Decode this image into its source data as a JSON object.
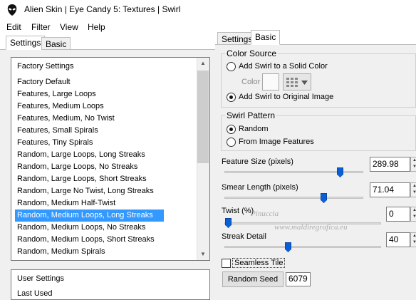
{
  "window": {
    "title": "Alien Skin | Eye Candy 5: Textures | Swirl",
    "icon": "alien-skin-app-icon"
  },
  "menu": [
    "Edit",
    "Filter",
    "View",
    "Help"
  ],
  "left_tabs": [
    "Settings",
    "Basic"
  ],
  "right_tabs": [
    "Settings",
    "Basic"
  ],
  "presets": {
    "header": "Factory Settings",
    "items": [
      "Factory Default",
      "Features, Large Loops",
      "Features, Medium Loops",
      "Features, Medium, No Twist",
      "Features, Small Spirals",
      "Features, Tiny Spirals",
      "Random, Large Loops, Long Streaks",
      "Random, Large Loops, No Streaks",
      "Random, Large Loops, Short Streaks",
      "Random, Large No Twist, Long Streaks",
      "Random, Medium Half-Twist",
      "Random, Medium Loops, Long Streaks",
      "Random, Medium Loops, No Streaks",
      "Random, Medium Loops, Short Streaks",
      "Random, Medium Spirals"
    ],
    "selected": "Random, Medium Loops, Long Streaks"
  },
  "user_presets": [
    "User Settings",
    "Last Used"
  ],
  "color_source": {
    "label": "Color Source",
    "option_solid": "Add Swirl to a Solid Color",
    "color_label": "Color",
    "option_original": "Add Swirl to Original Image",
    "selected": "Add Swirl to Original Image"
  },
  "swirl_pattern": {
    "label": "Swirl Pattern",
    "option_random": "Random",
    "option_features": "From Image Features",
    "selected": "Random"
  },
  "params": {
    "feature_size": {
      "label": "Feature Size (pixels)",
      "value": "289.98"
    },
    "smear_length": {
      "label": "Smear Length (pixels)",
      "value": "71.04"
    },
    "twist": {
      "label": "Twist (%)",
      "value": "0"
    },
    "streak_detail": {
      "label": "Streak Detail",
      "value": "40"
    }
  },
  "seamless_tile": {
    "label": "Seamless Tile",
    "checked": false
  },
  "random_seed": {
    "button": "Random Seed",
    "value": "6079"
  },
  "watermark": {
    "line1": "Pinuccia",
    "line2": "www.maldiregrafica.eu"
  },
  "colors": {
    "selection": "#3399ff",
    "slider_thumb": "#0a5fd6",
    "panel_bg": "#f0f0f0"
  }
}
